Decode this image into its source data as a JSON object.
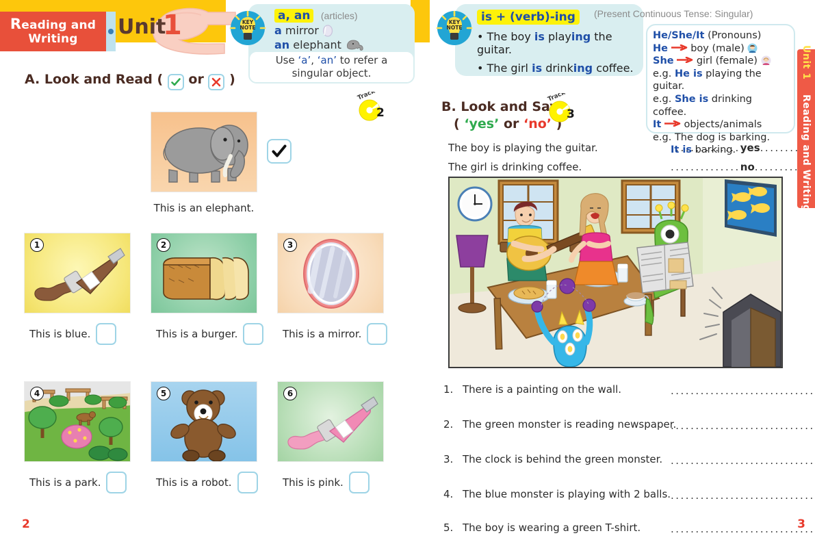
{
  "book": {
    "banner_line1": "Reading and",
    "banner_line2": "Writing",
    "unit_label": "Unit",
    "unit_number": "1",
    "side_tab_unit": "Unit 1",
    "side_tab_section": "Reading and Writing",
    "page_left": "2",
    "page_right": "3",
    "keynote_label_line1": "KEY",
    "keynote_label_line2": "NOTE"
  },
  "left_keynote": {
    "headword": "a, an",
    "headword_note": "(articles)",
    "example1_article": "a",
    "example1_word": "mirror",
    "example2_article": "an",
    "example2_word": "elephant",
    "rule_prefix": "Use ",
    "rule_a": "‘a’",
    "rule_comma": ", ",
    "rule_an": "‘an’",
    "rule_suffix": " to refer a singular object."
  },
  "section_a": {
    "heading_prefix": "A. Look and Read (",
    "heading_or": "or",
    "heading_suffix": ")",
    "check_icon": "check-icon",
    "cross_icon": "cross-icon",
    "track_word": "Track",
    "track_number": "2",
    "example": {
      "caption": "This is an elephant.",
      "image": "elephant-illustration",
      "answer": "check"
    },
    "items": [
      {
        "num": "1",
        "caption": "This is blue.",
        "image": "brown-paint-tube-illustration",
        "answer": ""
      },
      {
        "num": "2",
        "caption": "This is a burger.",
        "image": "bread-loaf-illustration",
        "answer": ""
      },
      {
        "num": "3",
        "caption": "This is a mirror.",
        "image": "mirror-illustration",
        "answer": ""
      },
      {
        "num": "4",
        "caption": "This is a park.",
        "image": "park-scene-illustration",
        "answer": ""
      },
      {
        "num": "5",
        "caption": "This is a robot.",
        "image": "teddy-bear-illustration",
        "answer": ""
      },
      {
        "num": "6",
        "caption": "This is pink.",
        "image": "pink-paint-tube-illustration",
        "answer": ""
      }
    ]
  },
  "right_keynote": {
    "headword_is": "is",
    "headword_rest": " + (verb)",
    "headword_ing": "-ing",
    "tense_note": "(Present Continuous Tense: Singular)",
    "bullet1_a": "The boy ",
    "bullet1_is": "is",
    "bullet1_b": " play",
    "bullet1_ing": "ing",
    "bullet1_c": " the guitar.",
    "bullet2_a": "The girl ",
    "bullet2_is": "is",
    "bullet2_b": " drink",
    "bullet2_ing": "ing",
    "bullet2_c": " coffee."
  },
  "pronouns_box": {
    "title_bold": "He/She/It",
    "title_rest": " (Pronouns)",
    "row_he_bold": "He",
    "row_he_rest": "boy (male)",
    "row_she_bold": "She",
    "row_she_rest": "girl (female)",
    "eg1_prefix": "e.g. ",
    "eg1_bold": "He is",
    "eg1_rest": " playing the guitar.",
    "eg2_prefix": "e.g. ",
    "eg2_bold": "She is",
    "eg2_rest": " drinking coffee.",
    "row_it_bold": "It",
    "row_it_rest": "objects/animals",
    "eg3": "e.g. The dog is barking.",
    "eg4_bold": "It is",
    "eg4_rest": " barking."
  },
  "section_b": {
    "heading_line1": "B. Look and Say",
    "heading_line2_open": "( ",
    "heading_yes": "‘yes’",
    "heading_or": " or ",
    "heading_no": "‘no’",
    "heading_line2_close": " )",
    "track_word": "Track",
    "track_number": "3",
    "samples": [
      {
        "text": "The boy is playing the guitar.",
        "answer": "yes"
      },
      {
        "text": "The girl is drinking coffee.",
        "answer": "no"
      }
    ],
    "scene_image": "living-room-with-monsters-illustration",
    "questions": [
      {
        "num": "1.",
        "text": "There is a painting on the wall.",
        "answer": ""
      },
      {
        "num": "2.",
        "text": "The green monster is reading newspaper.",
        "answer": ""
      },
      {
        "num": "3.",
        "text": "The clock is behind the green monster.",
        "answer": ""
      },
      {
        "num": "4.",
        "text": "The blue monster is playing with 2 balls.",
        "answer": ""
      },
      {
        "num": "5.",
        "text": "The boy is wearing a green T-shirt.",
        "answer": ""
      }
    ],
    "answer_line_dots": "...............................",
    "sample_dots_left": "..............",
    "sample_dots_right": "............"
  },
  "colors": {
    "banner_red": "#e8503a",
    "banner_yellow": "#fdc70c",
    "keynote_bg": "#d9eef0",
    "accent_blue": "#1f4fa8",
    "box_border": "#9ed4e6",
    "page_number_red": "#e8392b",
    "yes_green": "#2faa4e",
    "no_red": "#e8392b"
  }
}
